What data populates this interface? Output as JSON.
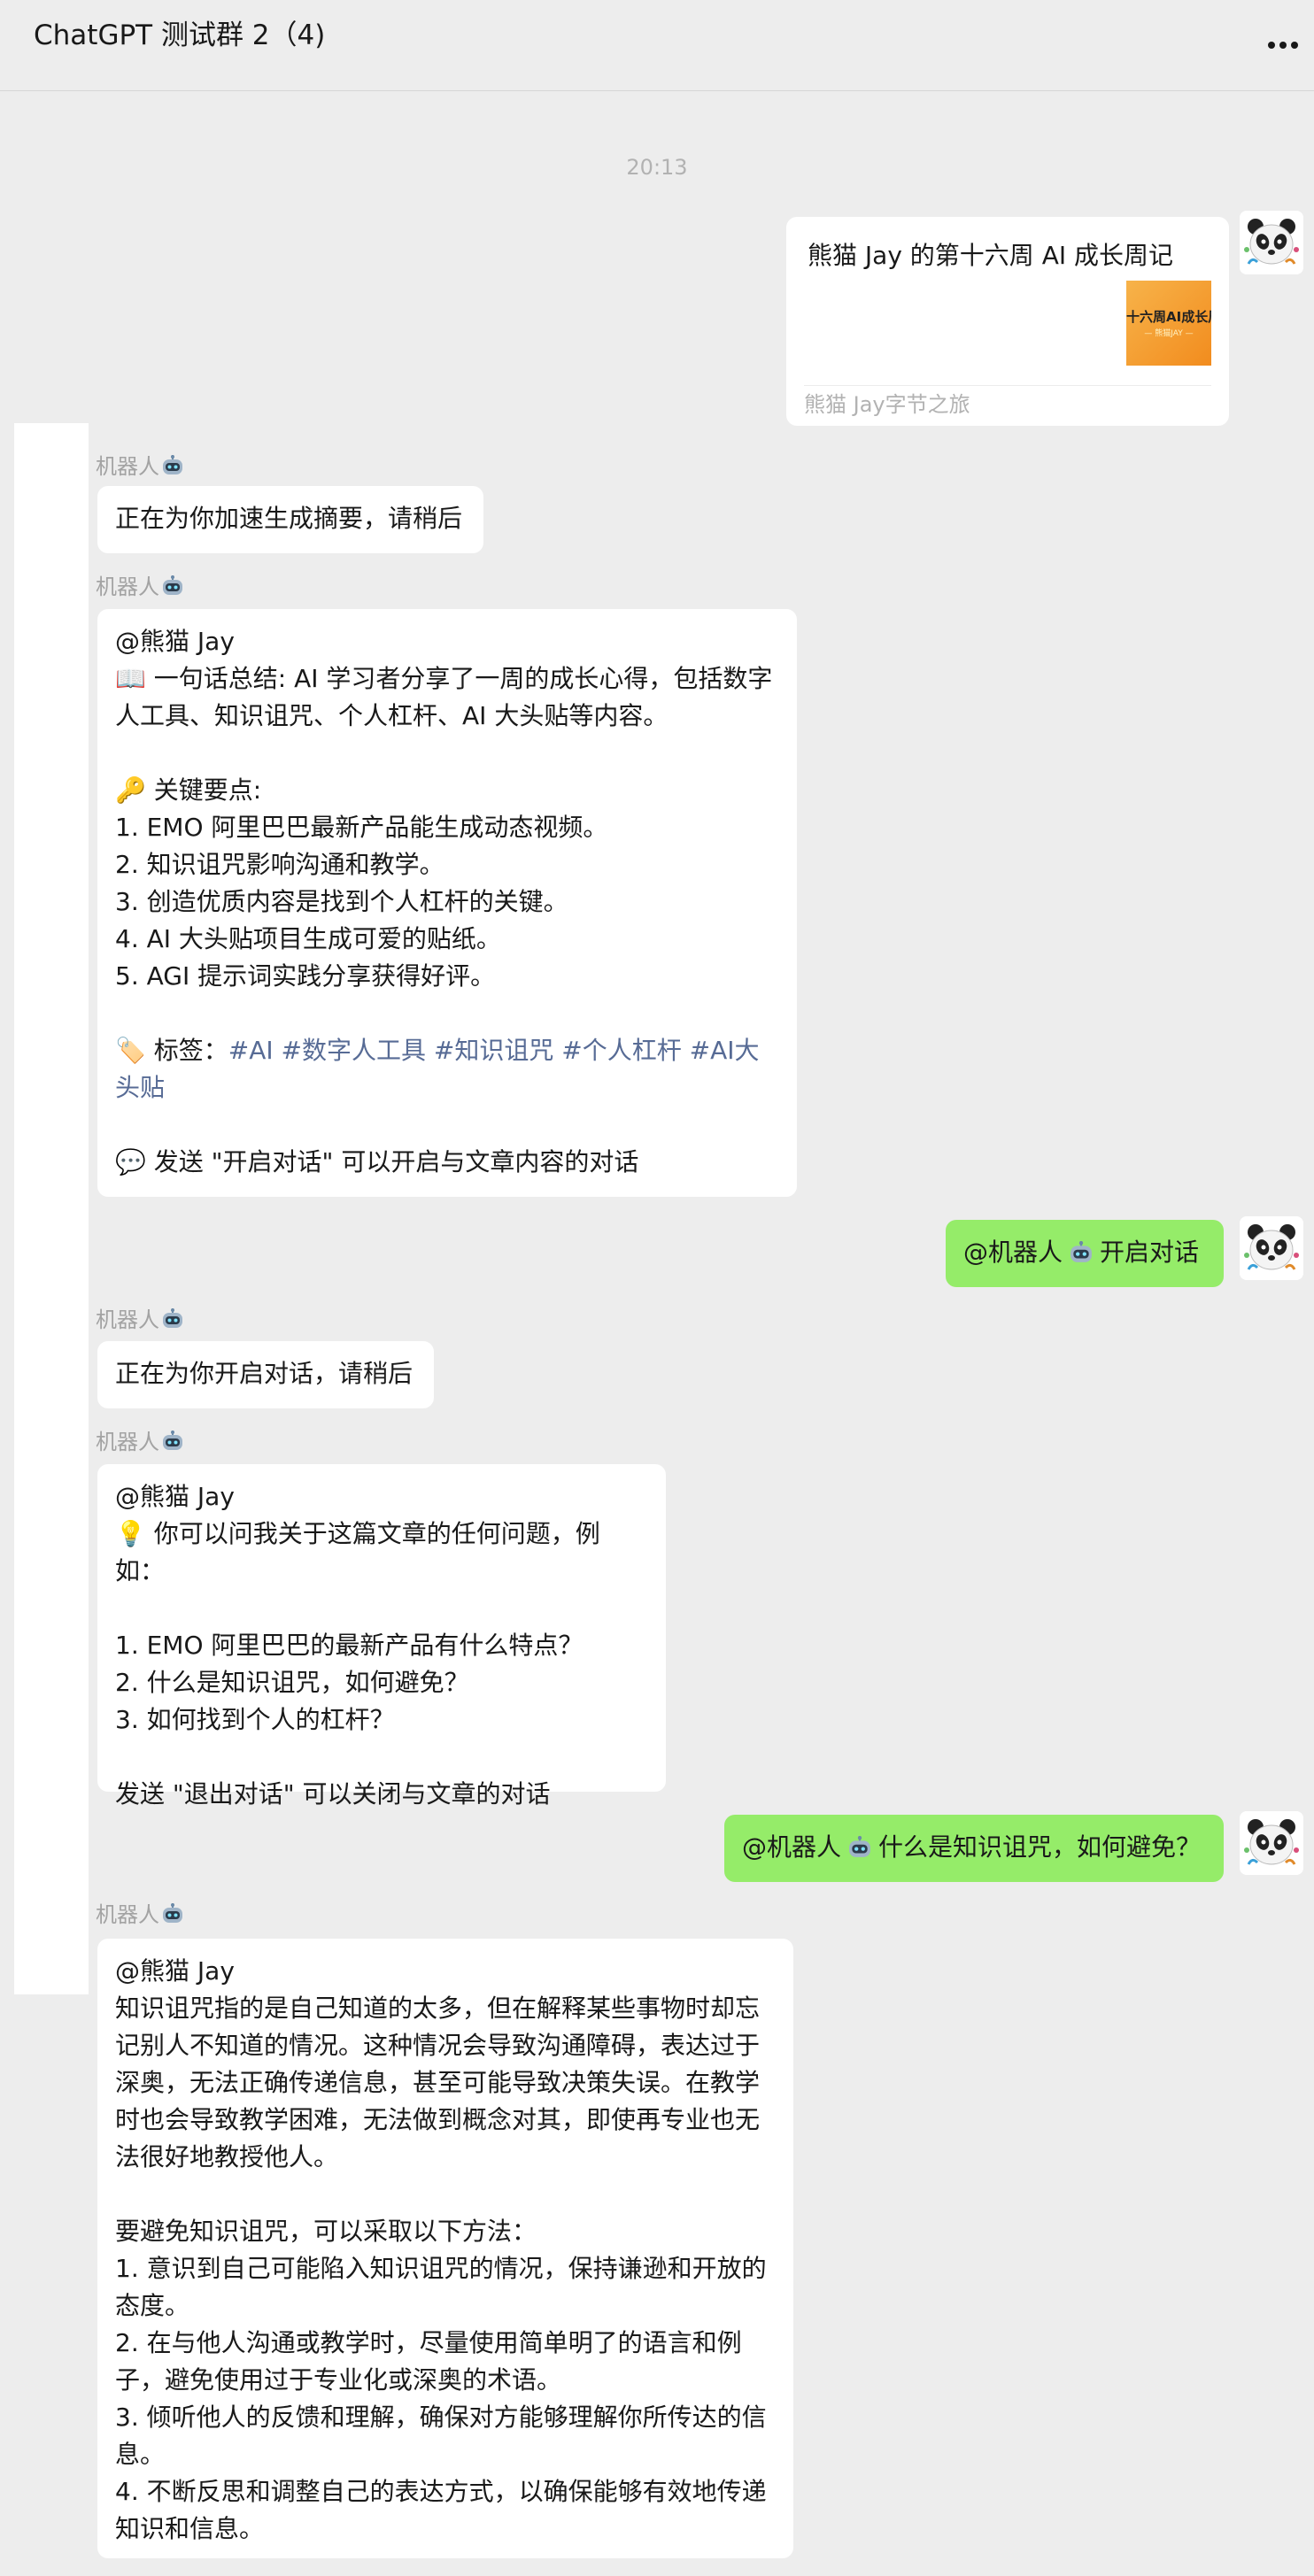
{
  "header": {
    "title": "ChatGPT 测试群 2（4)"
  },
  "time_divider": "20:13",
  "card": {
    "title": "熊猫 Jay 的第十六周 AI 成长周记",
    "thumb_title": "十六周AI成长周记",
    "thumb_sub": "— 熊猫JAY —",
    "source": "熊猫 Jay字节之旅"
  },
  "bot_name": "机器人",
  "messages": {
    "m1": "正在为你加速生成摘要，请稍后",
    "m2": {
      "mention": "@熊猫 Jay",
      "summary": "📖 一句话总结: AI 学习者分享了一周的成长心得，包括数字人工具、知识诅咒、个人杠杆、AI 大头贴等内容。",
      "key_title": "🔑 关键要点:",
      "points": [
        "1. EMO 阿里巴巴最新产品能生成动态视频。",
        "2. 知识诅咒影响沟通和教学。",
        "3. 创造优质内容是找到个人杠杆的关键。",
        "4. AI 大头贴项目生成可爱的贴纸。",
        "5. AGI 提示词实践分享获得好评。"
      ],
      "tags_label": "🏷️ 标签：",
      "tags": "#AI #数字人工具 #知识诅咒 #个人杠杆 #AI大头贴",
      "footer": "💬 发送 \"开启对话\" 可以开启与文章内容的对话"
    },
    "user2_prefix": "@机器人",
    "user2_text": "开启对话",
    "m3": "正在为你开启对话，请稍后",
    "m4": {
      "mention": "@熊猫 Jay",
      "intro": "💡 你可以问我关于这篇文章的任何问题，例如：",
      "questions": [
        "1. EMO 阿里巴巴的最新产品有什么特点？",
        "2. 什么是知识诅咒，如何避免？",
        "3. 如何找到个人的杠杆？"
      ],
      "footer": "发送 \"退出对话\" 可以关闭与文章的对话"
    },
    "user3_prefix": "@机器人",
    "user3_text": "什么是知识诅咒，如何避免？",
    "m5": {
      "mention": "@熊猫 Jay",
      "para1": "知识诅咒指的是自己知道的太多，但在解释某些事物时却忘记别人不知道的情况。这种情况会导致沟通障碍，表达过于深奥，无法正确传递信息，甚至可能导致决策失误。在教学时也会导致教学困难，无法做到概念对其，即使再专业也无法很好地教授他人。",
      "para2": "要避免知识诅咒，可以采取以下方法：",
      "methods": [
        "1. 意识到自己可能陷入知识诅咒的情况，保持谦逊和开放的态度。",
        "2. 在与他人沟通或教学时，尽量使用简单明了的语言和例子，避免使用过于专业化或深奥的术语。",
        "3. 倾听他人的反馈和理解，确保对方能够理解你所传达的信息。",
        "4. 不断反思和调整自己的表达方式，以确保能够有效地传递知识和信息。"
      ]
    }
  }
}
